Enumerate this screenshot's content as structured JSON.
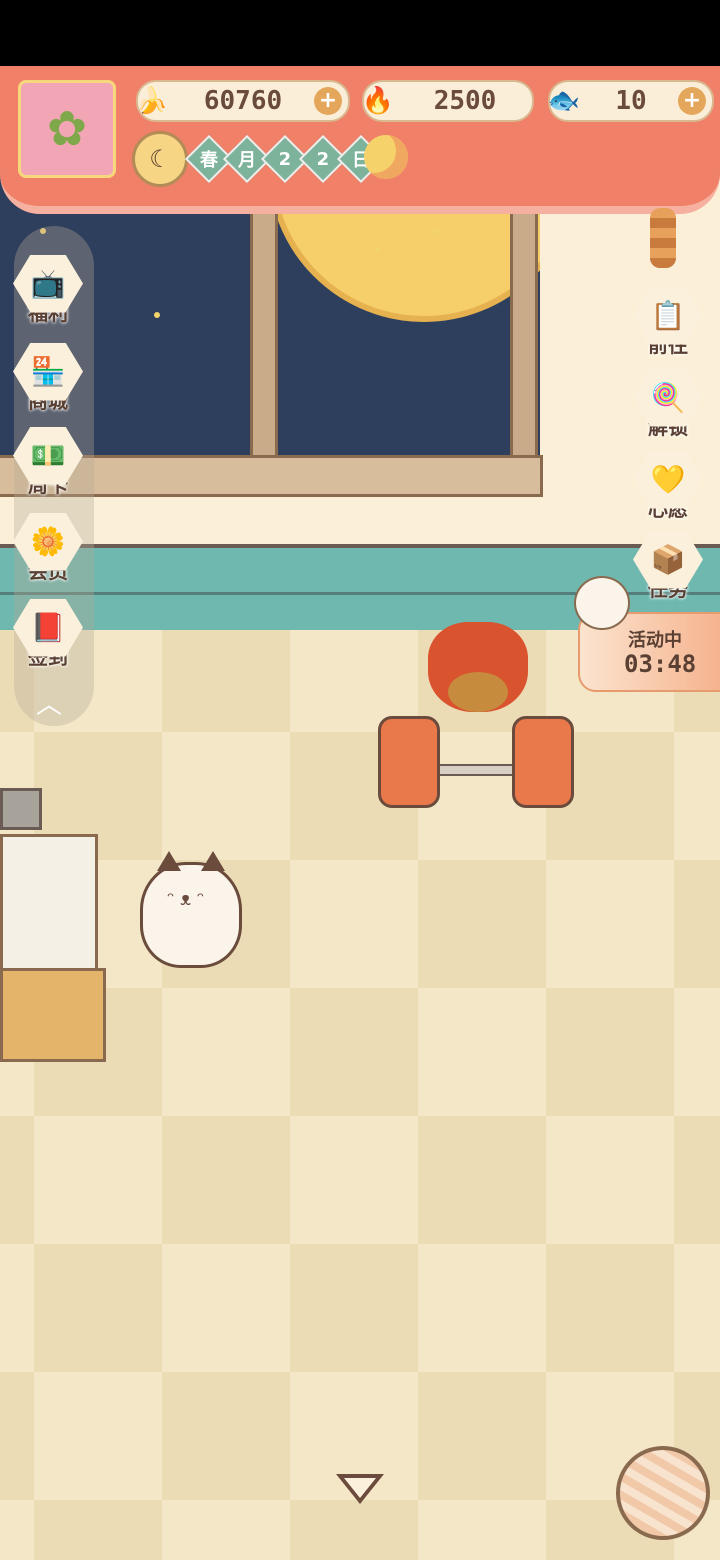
{
  "resources": {
    "banana": {
      "icon": "banana-icon",
      "value": "60760",
      "plus": "+"
    },
    "fire": {
      "icon": "fire-icon",
      "value": "2500"
    },
    "fish": {
      "icon": "fish-icon",
      "value": "10",
      "plus": "+"
    }
  },
  "date": {
    "season": "春",
    "month_label": "月",
    "day1": "2",
    "day2": "2",
    "day_label": "日"
  },
  "left_menu": [
    {
      "label": "福利",
      "icon": "tv-icon"
    },
    {
      "label": "商城",
      "icon": "shop-icon"
    },
    {
      "label": "周卡",
      "icon": "weekly-card-icon"
    },
    {
      "label": "会员",
      "icon": "flower-icon"
    },
    {
      "label": "签到",
      "icon": "calendar-icon"
    }
  ],
  "right_menu": [
    {
      "label": "前往",
      "icon": "board-icon"
    },
    {
      "label": "解锁",
      "icon": "lollipop-icon"
    },
    {
      "label": "心愿",
      "icon": "heart-book-icon"
    },
    {
      "label": "任务",
      "icon": "task-box-icon"
    }
  ],
  "event": {
    "status": "活动中",
    "timer": "03:48"
  },
  "colors": {
    "banner": "#f08068",
    "teal_rail": "#6fb8b0",
    "night_sky": "#2e3e5d"
  }
}
